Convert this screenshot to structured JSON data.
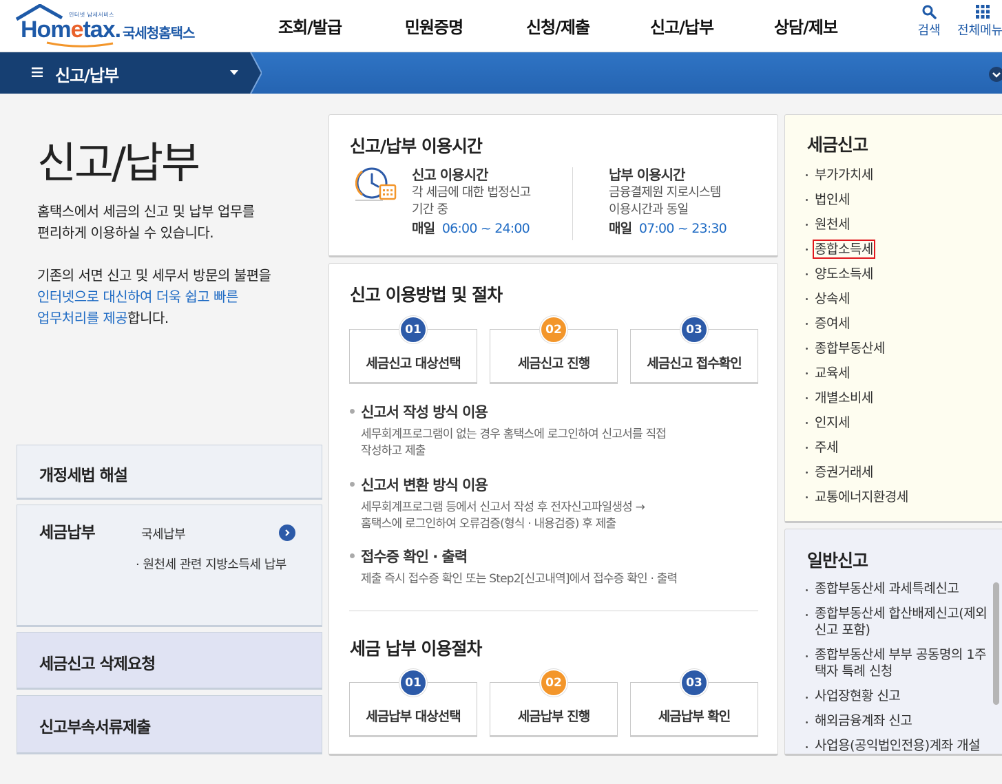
{
  "header": {
    "logo_tagline": "인터넷 납세서비스",
    "logo_text_prefix": "Hom",
    "logo_text_e": "e",
    "logo_text_suffix": "tax.",
    "logo_sub": "국세청홈택스",
    "nav": [
      "조회/발급",
      "민원증명",
      "신청/제출",
      "신고/납부",
      "상담/제보"
    ],
    "search_label": "검색",
    "all_menu_label": "전체메뉴"
  },
  "location": {
    "title": "신고/납부"
  },
  "intro": {
    "title": "신고/납부",
    "p1_line1": "홈택스에서 세금의 신고 및 납부 업무를",
    "p1_line2": "편리하게 이용하실 수 있습니다.",
    "p2_line1": "기존의 서면 신고 및 세무서 방문의 불편을",
    "p2_hl1": "인터넷으로 대신하여 더욱 쉽고 빠른",
    "p2_hl2": "업무처리를 제공",
    "p2_tail": "합니다."
  },
  "side_cards": {
    "revision": "개정세법 해설",
    "payment": {
      "title": "세금납부",
      "link1": "국세납부",
      "link2": "· 원천세 관련 지방소득세 납부"
    },
    "delete": "세금신고 삭제요청",
    "docs": "신고부속서류제출"
  },
  "hours": {
    "title": "신고/납부 이용시간",
    "report": {
      "heading": "신고 이용시간",
      "desc1": "각 세금에 대한 법정신고",
      "desc2": "기간 중",
      "daily": "매일",
      "time": "06:00 ~ 24:00"
    },
    "pay": {
      "heading": "납부 이용시간",
      "desc1": "금융결제원 지로시스템",
      "desc2": "이용시간과 동일",
      "daily": "매일",
      "time": "07:00 ~ 23:30"
    }
  },
  "procedure": {
    "title": "신고 이용방법 및 절차",
    "steps": [
      {
        "num": "01",
        "label": "세금신고 대상선택"
      },
      {
        "num": "02",
        "label": "세금신고 진행"
      },
      {
        "num": "03",
        "label": "세금신고 접수확인"
      }
    ],
    "methods": [
      {
        "title": "신고서 작성 방식 이용",
        "desc1": "세무회계프로그램이 없는 경우 홈택스에 로그인하여 신고서를 직접",
        "desc2": "작성하고 제출"
      },
      {
        "title": "신고서 변환 방식 이용",
        "desc1": "세무회계프로그램 등에서 신고서 작성 후 전자신고파일생성 →",
        "desc2": "홈택스에 로그인하여 오류검증(형식 · 내용검증) 후 제출"
      },
      {
        "title": "접수증 확인 · 출력",
        "desc1": "제출 즉시 접수증 확인 또는 Step2[신고내역]에서 접수증 확인 · 출력",
        "desc2": ""
      }
    ],
    "pay_title": "세금 납부 이용절차",
    "pay_steps": [
      {
        "num": "01",
        "label": "세금납부 대상선택"
      },
      {
        "num": "02",
        "label": "세금납부 진행"
      },
      {
        "num": "03",
        "label": "세금납부 확인"
      }
    ]
  },
  "tax_report": {
    "title": "세금신고",
    "items": [
      "부가가치세",
      "법인세",
      "원천세",
      "종합소득세",
      "양도소득세",
      "상속세",
      "증여세",
      "종합부동산세",
      "교육세",
      "개별소비세",
      "인지세",
      "주세",
      "증권거래세",
      "교통에너지환경세"
    ],
    "selected_index": 3
  },
  "general_report": {
    "title": "일반신고",
    "items": [
      {
        "l1": "종합부동산세 과세특례신고",
        "l2": ""
      },
      {
        "l1": "종합부동산세 합산배제신고(제외",
        "l2": "신고 포함)"
      },
      {
        "l1": "종합부동산세 부부 공동명의 1주",
        "l2": "택자 특례 신청"
      },
      {
        "l1": "사업장현황 신고",
        "l2": ""
      },
      {
        "l1": "해외금융계좌 신고",
        "l2": ""
      },
      {
        "l1": "사업용(공익법인전용)계좌 개설",
        "l2": ""
      }
    ]
  },
  "colors": {
    "brand_blue": "#1e5aa8",
    "accent_orange": "#f3962b",
    "highlight_red": "#e1161c",
    "link_blue": "#1f6bc4"
  }
}
